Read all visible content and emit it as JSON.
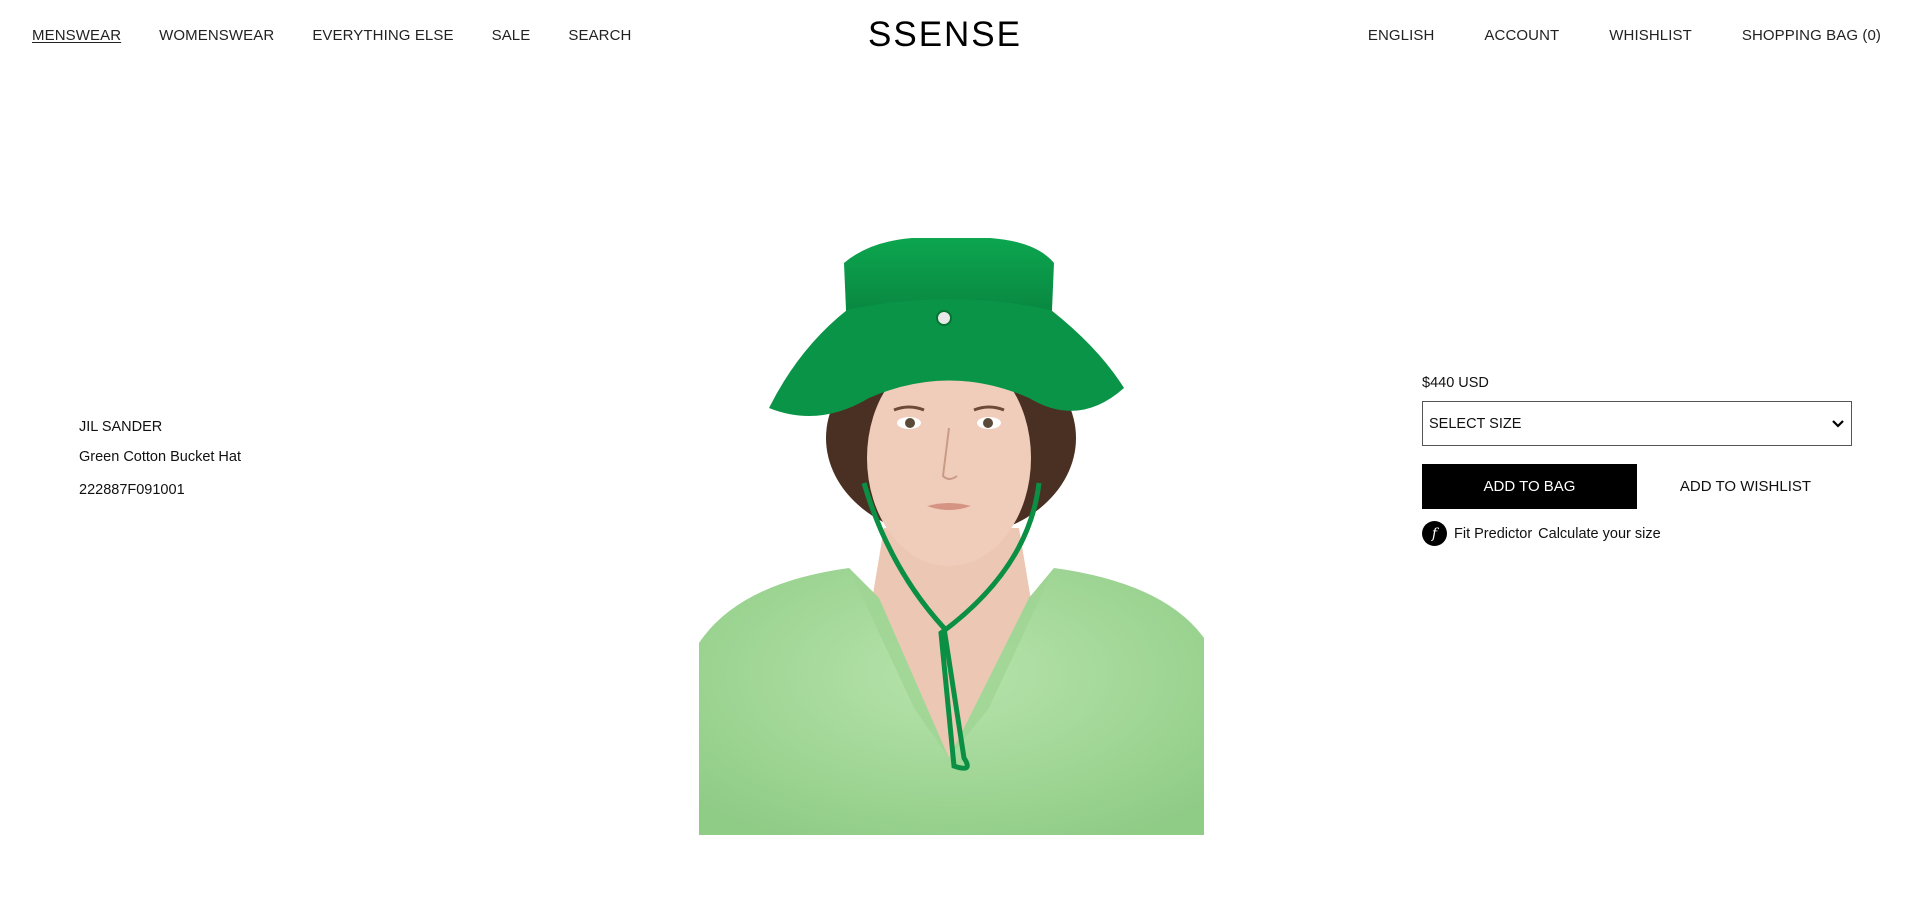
{
  "header": {
    "logo": "SSENSE",
    "nav_left": [
      "MENSWEAR",
      "WOMENSWEAR",
      "EVERYTHING ELSE",
      "SALE",
      "SEARCH"
    ],
    "nav_right": [
      "ENGLISH",
      "ACCOUNT",
      "WHISHLIST",
      "SHOPPING BAG (0)"
    ]
  },
  "product": {
    "brand": "JIL SANDER",
    "name": "Green Cotton Bucket Hat",
    "sku": "222887F091001"
  },
  "purchase": {
    "price": "$440 USD",
    "size_placeholder": "SELECT SIZE",
    "add_to_bag": "ADD TO BAG",
    "add_to_wishlist": "ADD TO WISHLIST",
    "fit_predictor": "Fit Predictor",
    "fit_calculate": "Calculate your size"
  },
  "colors": {
    "hat_green": "#0a9447",
    "sweater_green": "#a6d99a",
    "button_black": "#000000"
  }
}
